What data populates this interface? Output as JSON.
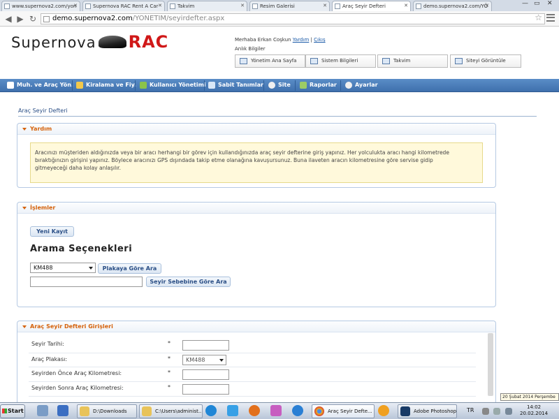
{
  "browser": {
    "tabs": [
      {
        "label": "www.supernova2.com/yon"
      },
      {
        "label": "Supernova RAC Rent A Car"
      },
      {
        "label": "Takvim"
      },
      {
        "label": "Resim Galerisi"
      },
      {
        "label": "Araç Seyir Defteri"
      },
      {
        "label": "demo.supernova2.com/YÖ"
      }
    ],
    "url_host": "demo.supernova2.com",
    "url_path": "/YONETIM/seyirdefter.aspx"
  },
  "header": {
    "logo_text": "Supernova",
    "logo_rac": "RAC",
    "welcome_prefix": "Merhaba Erkan Coşkun",
    "help_link": "Yardım",
    "separator": "|",
    "logout_link": "Çıkış",
    "last_login": "Anlık Bilgiler",
    "quick_buttons": [
      {
        "label": "Yönetim Ana Sayfa"
      },
      {
        "label": "Sistem Bilgileri"
      },
      {
        "label": "Takvim"
      },
      {
        "label": "Siteyi Görüntüle"
      }
    ]
  },
  "menu": {
    "items": [
      {
        "label": "Muh. ve Araç Yön.",
        "color": "#ffffff"
      },
      {
        "label": "Kiralama ve Fiy.",
        "color": "#f2c84b"
      },
      {
        "label": "Kullanıcı Yönetimi",
        "color": "#8bc34a"
      },
      {
        "label": "Sabit Tanımlar",
        "color": "#d9e7f7"
      },
      {
        "label": "Site",
        "color": "#f0f0f0"
      },
      {
        "label": "Raporlar",
        "color": "#9ccc65"
      },
      {
        "label": "Ayarlar",
        "color": "#f0f0f0"
      }
    ]
  },
  "page": {
    "title": "Araç Seyir Defteri",
    "help_panel": {
      "title": "Yardım",
      "line1": "Aracınızı müşteriden aldığınızda veya bir aracı herhangi bir görev için kullandığınızda araç seyir defterine giriş yapınız. Her yolculukta aracı hangi kilometrede",
      "line2": "bıraktığınızın girişini yapınız. Böylece aracınızı GPS dışındada takip etme olanağına kavuşursunuz. Buna ilaveten aracın kilometresine göre servise gidip",
      "line3": "gitmeyeceği daha kolay anlaşılır."
    },
    "ops_panel": {
      "title": "İşlemler",
      "new_record": "Yeni Kayıt",
      "search_title": "Arama Seçenekleri",
      "plate_select": "KM488",
      "plate_button": "Plakaya Göre Ara",
      "reason_input": "",
      "reason_button": "Seyir Sebebine Göre Ara"
    },
    "entries_panel": {
      "title": "Araç Seyir Defteri Girişleri",
      "rows": [
        {
          "label": "Seyir Tarihi:",
          "required": "*",
          "value": ""
        },
        {
          "label": "Araç Plakası:",
          "required": "*",
          "value": "KM488"
        },
        {
          "label": "Seyirden Önce Araç Kilometresi:",
          "required": "*",
          "value": ""
        },
        {
          "label": "Seyirden Sonra Araç Kilometresi:",
          "required": "*",
          "value": ""
        }
      ]
    }
  },
  "tooltip": "20 Şubat 2014 Perşembe",
  "taskbar": {
    "start": "Start",
    "buttons": [
      {
        "label": "D:\\Downloads"
      },
      {
        "label": "C:\\Users\\administ..."
      },
      {
        "label": "Araç Seyir Defte..."
      },
      {
        "label": "Adobe Photoshop..."
      }
    ],
    "lang": "TR",
    "time": "14:02",
    "date": "20.02.2014"
  }
}
